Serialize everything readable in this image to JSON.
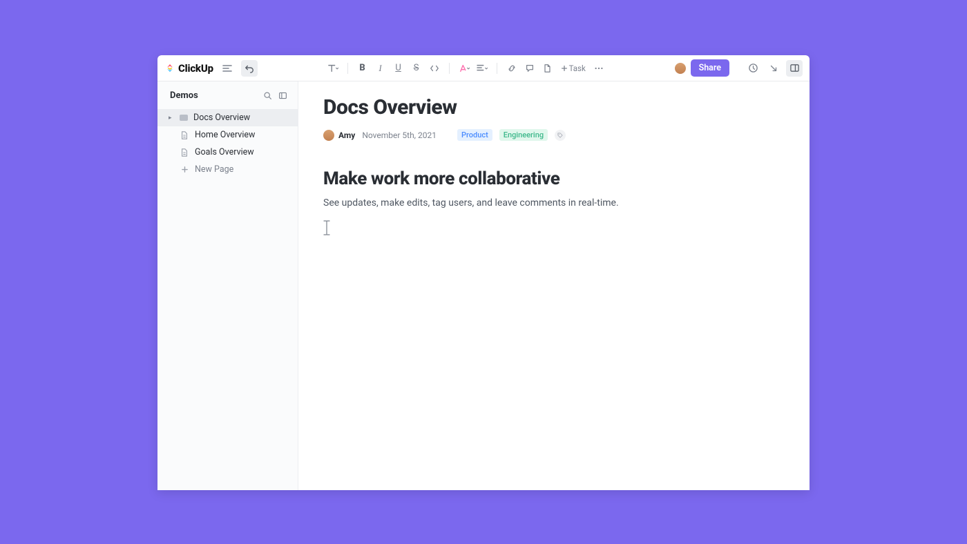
{
  "brand": {
    "name": "ClickUp"
  },
  "toolbar": {
    "task_label": "Task"
  },
  "topbar_right": {
    "share_label": "Share"
  },
  "sidebar": {
    "title": "Demos",
    "items": [
      {
        "label": "Docs Overview",
        "icon": "filled",
        "active": true
      },
      {
        "label": "Home Overview",
        "icon": "doc",
        "active": false
      },
      {
        "label": "Goals Overview",
        "icon": "doc",
        "active": false
      }
    ],
    "new_page_label": "New Page"
  },
  "document": {
    "title": "Docs Overview",
    "author": "Amy",
    "date": "November 5th, 2021",
    "tags": [
      {
        "label": "Product",
        "cls": "product"
      },
      {
        "label": "Engineering",
        "cls": "eng"
      }
    ],
    "heading": "Make work more collaborative",
    "body": "See updates, make edits, tag users, and leave comments in real-time."
  }
}
